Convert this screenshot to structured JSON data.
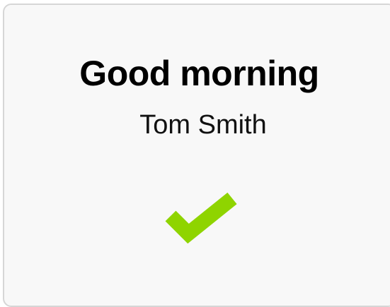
{
  "card": {
    "greeting": "Good morning",
    "name": "Tom Smith",
    "status_icon": "checkmark-icon",
    "accent_color": "#8fd400"
  }
}
